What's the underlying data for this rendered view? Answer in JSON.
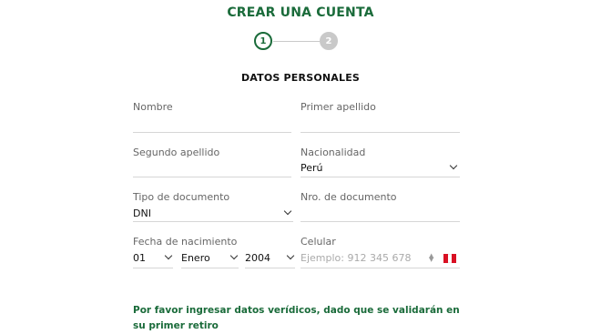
{
  "header": {
    "title": "CREAR UNA CUENTA"
  },
  "steps": [
    {
      "label": "1",
      "active": true
    },
    {
      "label": "2",
      "active": false
    }
  ],
  "section_title": "DATOS PERSONALES",
  "form": {
    "nombre": {
      "label": "Nombre",
      "value": ""
    },
    "primer_apellido": {
      "label": "Primer apellido",
      "value": ""
    },
    "segundo_apellido": {
      "label": "Segundo apellido",
      "value": ""
    },
    "nacionalidad": {
      "label": "Nacionalidad",
      "value": "Perú"
    },
    "tipo_documento": {
      "label": "Tipo de documento",
      "value": "DNI"
    },
    "nro_documento": {
      "label": "Nro. de documento",
      "value": ""
    },
    "fecha_nacimiento": {
      "label": "Fecha de nacimiento",
      "day": "01",
      "month": "Enero",
      "year": "2004"
    },
    "celular": {
      "label": "Celular",
      "placeholder": "Ejemplo: 912 345 678",
      "country_flag": "peru-flag-icon"
    }
  },
  "notice": "Por favor ingresar datos verídicos, dado que se validarán en su primer retiro",
  "colors": {
    "brand_green": "#1a6b3a",
    "line": "#d6d6d6",
    "label": "#666666"
  }
}
